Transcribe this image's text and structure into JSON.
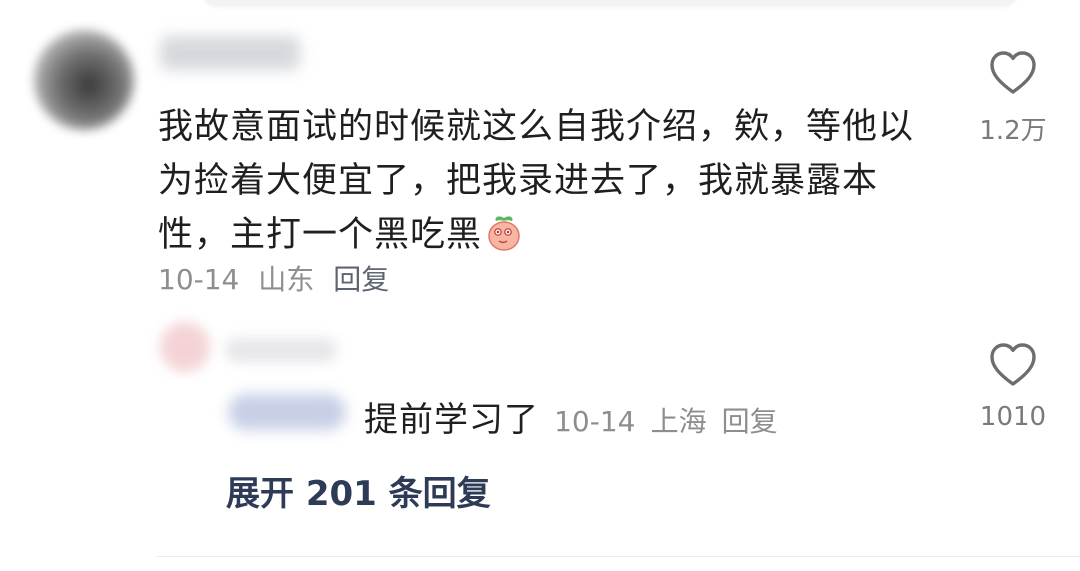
{
  "comment": {
    "text": "我故意面试的时候就这么自我介绍，欸，等他以为捡着大便宜了，把我录进去了，我就暴露本性，主打一个黑吃黑",
    "emoji": "peach-emoji",
    "date": "10-14",
    "location": "山东",
    "reply_label": "回复",
    "like_count": "1.2万"
  },
  "reply": {
    "text": "提前学习了",
    "date": "10-14",
    "location": "上海",
    "reply_label": "回复",
    "like_count": "1010"
  },
  "expand": {
    "label": "展开 201 条回复"
  },
  "icons": {
    "like": "heart-outline-icon"
  },
  "colors": {
    "text": "#1f1f1f",
    "meta": "#8e8e8e",
    "link": "#2e3b57"
  }
}
